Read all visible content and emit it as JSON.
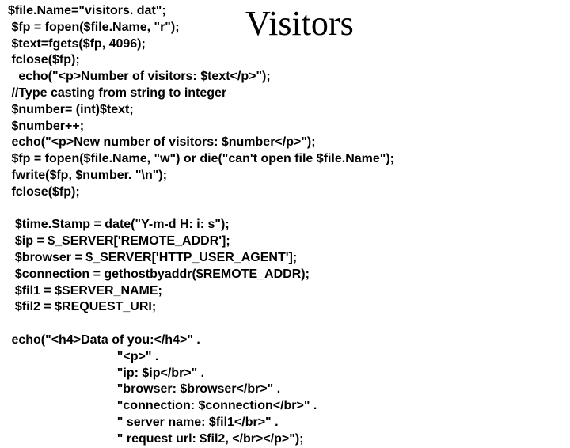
{
  "title": "Visitors",
  "code": "$file.Name=\"visitors. dat\";\n $fp = fopen($file.Name, \"r\");\n $text=fgets($fp, 4096);\n fclose($fp);\n   echo(\"<p>Number of visitors: $text</p>\");\n //Type casting from string to integer\n $number= (int)$text;\n $number++;\n echo(\"<p>New number of visitors: $number</p>\");\n $fp = fopen($file.Name, \"w\") or die(\"can't open file $file.Name\");\n fwrite($fp, $number. \"\\n\");\n fclose($fp);\n\n  $time.Stamp = date(\"Y-m-d H: i: s\");\n  $ip = $_SERVER['REMOTE_ADDR'];\n  $browser = $_SERVER['HTTP_USER_AGENT'];\n  $connection = gethostbyaddr($REMOTE_ADDR);\n  $fil1 = $SERVER_NAME;\n  $fil2 = $REQUEST_URI;\n\n echo(\"<h4>Data of you:</h4>\" .\n                               \"<p>\" .\n                               \"ip: $ip</br>\" .\n                               \"browser: $browser</br>\" .\n                               \"connection: $connection</br>\" .\n                               \" server name: $fil1</br>\" .\n                               \" request url: $fil2, </br></p>\");"
}
